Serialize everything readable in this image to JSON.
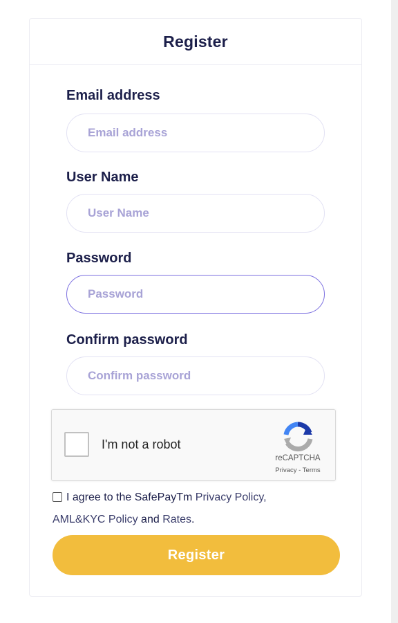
{
  "form": {
    "title": "Register",
    "fields": [
      {
        "label": "Email address",
        "placeholder": "Email address",
        "value": ""
      },
      {
        "label": "User Name",
        "placeholder": "User Name",
        "value": ""
      },
      {
        "label": "Password",
        "placeholder": "Password",
        "value": ""
      },
      {
        "label": "Confirm password",
        "placeholder": "Confirm password",
        "value": ""
      }
    ],
    "recaptcha": {
      "label": "I'm not a robot",
      "brand": "reCAPTCHA",
      "privacy": "Privacy",
      "separator": " - ",
      "terms": "Terms"
    },
    "agreement": {
      "text_prefix": "I agree to the SafePayTm ",
      "privacy_link": "Privacy Policy,",
      "aml_link": "AML&KYC Policy",
      "and_text": " and ",
      "rates_link": "Rates",
      "suffix": "."
    },
    "submit_label": "Register"
  },
  "colors": {
    "title": "#1c1f4a",
    "placeholder": "#a8a3d6",
    "input_border": "#e2e1f3",
    "focus_border": "#7b6fe0",
    "button": "#f2bd3d"
  }
}
